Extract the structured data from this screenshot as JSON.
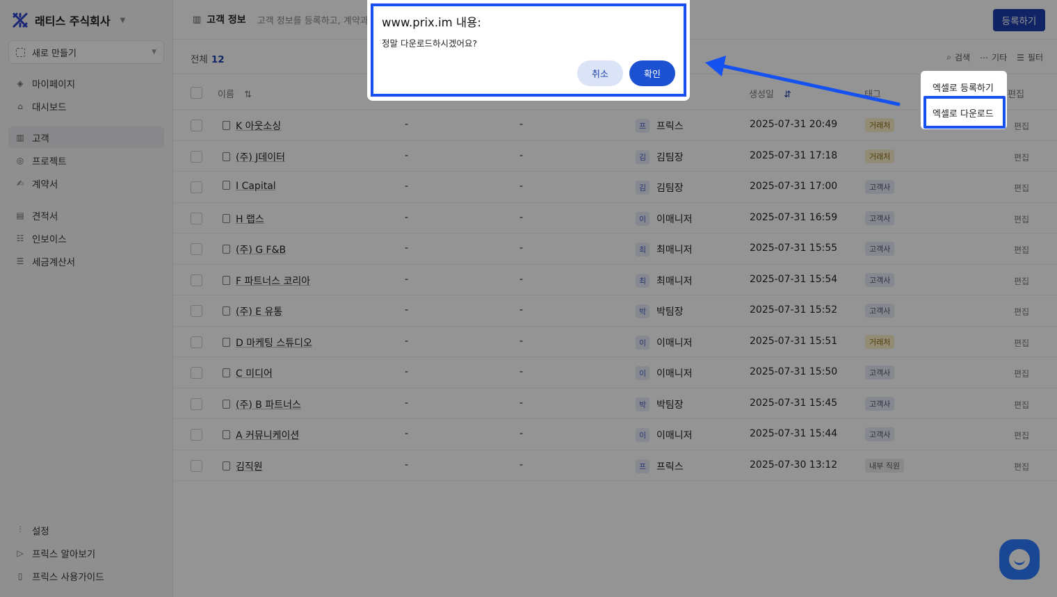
{
  "sidebar": {
    "company_name": "래티스 주식회사",
    "new_button": "새로 만들기",
    "items": [
      {
        "label": "마이페이지",
        "icon": "diamond-icon"
      },
      {
        "label": "대시보드",
        "icon": "home-icon"
      },
      {
        "label": "고객",
        "icon": "building-icon"
      },
      {
        "label": "프로젝트",
        "icon": "target-icon"
      },
      {
        "label": "계약서",
        "icon": "sign-icon"
      },
      {
        "label": "견적서",
        "icon": "document-icon"
      },
      {
        "label": "인보이스",
        "icon": "invoice-icon"
      },
      {
        "label": "세금계산서",
        "icon": "receipt-icon"
      }
    ],
    "bottom_items": [
      {
        "label": "설정",
        "icon": "sliders-icon"
      },
      {
        "label": "프릭스 알아보기",
        "icon": "play-icon"
      },
      {
        "label": "프릭스 사용가이드",
        "icon": "book-icon"
      }
    ]
  },
  "header": {
    "title": "고객 정보",
    "description": "고객 정보를 등록하고, 계약과",
    "register_button": "등록하기"
  },
  "toolbar": {
    "total_label": "전체",
    "total_count": "12",
    "search_label": "검색",
    "more_label": "기타",
    "filter_label": "필터"
  },
  "table": {
    "headers": {
      "name": "이름",
      "created": "생성일",
      "tag": "태그",
      "edit": "편집"
    },
    "rows": [
      {
        "name": "K 아웃소싱",
        "col2": "-",
        "col3": "-",
        "avatar": "프",
        "manager": "프릭스",
        "created": "2025-07-31 20:49",
        "tag": "거래처",
        "tag_type": "deal",
        "edit": "편집"
      },
      {
        "name": "(주) J데이터",
        "col2": "-",
        "col3": "-",
        "avatar": "김",
        "manager": "김팀장",
        "created": "2025-07-31 17:18",
        "tag": "거래처",
        "tag_type": "deal",
        "edit": "편집"
      },
      {
        "name": "I Capital",
        "col2": "-",
        "col3": "-",
        "avatar": "김",
        "manager": "김팀장",
        "created": "2025-07-31 17:00",
        "tag": "고객사",
        "tag_type": "client",
        "edit": "편집"
      },
      {
        "name": "H 랩스",
        "col2": "-",
        "col3": "-",
        "avatar": "이",
        "manager": "이매니저",
        "created": "2025-07-31 16:59",
        "tag": "고객사",
        "tag_type": "client",
        "edit": "편집"
      },
      {
        "name": "(주) G F&B",
        "col2": "-",
        "col3": "-",
        "avatar": "최",
        "manager": "최매니저",
        "created": "2025-07-31 15:55",
        "tag": "고객사",
        "tag_type": "client",
        "edit": "편집"
      },
      {
        "name": "F 파트너스 코리아",
        "col2": "-",
        "col3": "-",
        "avatar": "최",
        "manager": "최매니저",
        "created": "2025-07-31 15:54",
        "tag": "고객사",
        "tag_type": "client",
        "edit": "편집"
      },
      {
        "name": "(주) E 유통",
        "col2": "-",
        "col3": "-",
        "avatar": "박",
        "manager": "박팀장",
        "created": "2025-07-31 15:52",
        "tag": "고객사",
        "tag_type": "client",
        "edit": "편집"
      },
      {
        "name": "D 마케팅 스튜디오",
        "col2": "-",
        "col3": "-",
        "avatar": "이",
        "manager": "이매니저",
        "created": "2025-07-31 15:51",
        "tag": "거래처",
        "tag_type": "deal",
        "edit": "편집"
      },
      {
        "name": "C 미디어",
        "col2": "-",
        "col3": "-",
        "avatar": "이",
        "manager": "이매니저",
        "created": "2025-07-31 15:50",
        "tag": "고객사",
        "tag_type": "client",
        "edit": "편집"
      },
      {
        "name": "(주) B 파트너스",
        "col2": "-",
        "col3": "-",
        "avatar": "박",
        "manager": "박팀장",
        "created": "2025-07-31 15:45",
        "tag": "고객사",
        "tag_type": "client",
        "edit": "편집"
      },
      {
        "name": "A 커뮤니케이션",
        "col2": "-",
        "col3": "-",
        "avatar": "이",
        "manager": "이매니저",
        "created": "2025-07-31 15:44",
        "tag": "고객사",
        "tag_type": "client",
        "edit": "편집"
      },
      {
        "name": "김직원",
        "col2": "-",
        "col3": "-",
        "avatar": "프",
        "manager": "프릭스",
        "created": "2025-07-30 13:12",
        "tag": "내부 직원",
        "tag_type": "internal",
        "edit": "편집"
      }
    ]
  },
  "dropdown": {
    "items": [
      "엑셀로 등록하기",
      "엑셀로 다운로드"
    ]
  },
  "dialog": {
    "title": "www.prix.im 내용:",
    "message": "정말 다운로드하시겠어요?",
    "cancel": "취소",
    "confirm": "확인"
  },
  "colors": {
    "accent": "#1c3fae",
    "annotation": "#1551ef",
    "chat": "#2e7bff"
  }
}
